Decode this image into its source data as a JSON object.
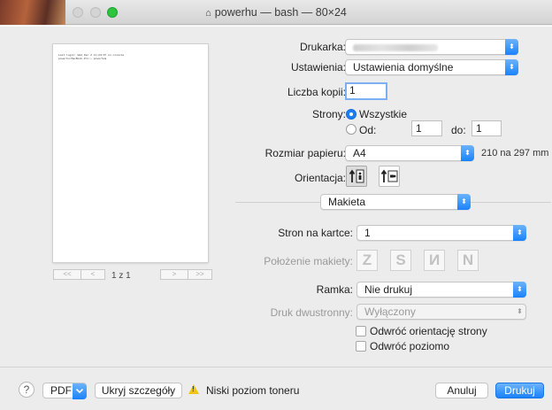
{
  "window": {
    "title": "powerhu — bash — 80×24",
    "home_icon": "home-icon"
  },
  "preview": {
    "lines": [
      "Last login: Wed Dec  2 11:24:07 on console",
      "powerhu:MacBook-Pro:~ powerhu$"
    ],
    "page_label": "1 z 1",
    "first_label": "<<",
    "prev_label": "<",
    "next_label": ">",
    "last_label": ">>"
  },
  "form": {
    "printer_label": "Drukarka:",
    "presets_label": "Ustawienia:",
    "presets_value": "Ustawienia domyślne",
    "copies_label": "Liczba kopii:",
    "copies_value": "1",
    "pages_label": "Strony:",
    "pages_all": "Wszystkie",
    "pages_from": "Od:",
    "pages_from_value": "1",
    "pages_to": "do:",
    "pages_to_value": "1",
    "paper_label": "Rozmiar papieru:",
    "paper_value": "A4",
    "paper_dims": "210 na 297 mm",
    "orientation_label": "Orientacja:",
    "section_value": "Makieta",
    "pages_per_sheet_label": "Stron na kartce:",
    "pages_per_sheet_value": "1",
    "layout_direction_label": "Położenie makiety:",
    "border_label": "Ramka:",
    "border_value": "Nie drukuj",
    "duplex_label": "Druk dwustronny:",
    "duplex_value": "Wyłączony",
    "reverse_orientation": "Odwróć orientację strony",
    "flip_horizontal": "Odwróć poziomo"
  },
  "bottom": {
    "help": "?",
    "pdf": "PDF",
    "hide_details": "Ukryj szczegóły",
    "toner_warning": "Niski poziom toneru",
    "cancel": "Anuluj",
    "print": "Drukuj"
  },
  "colors": {
    "accent": "#1a82fb"
  }
}
